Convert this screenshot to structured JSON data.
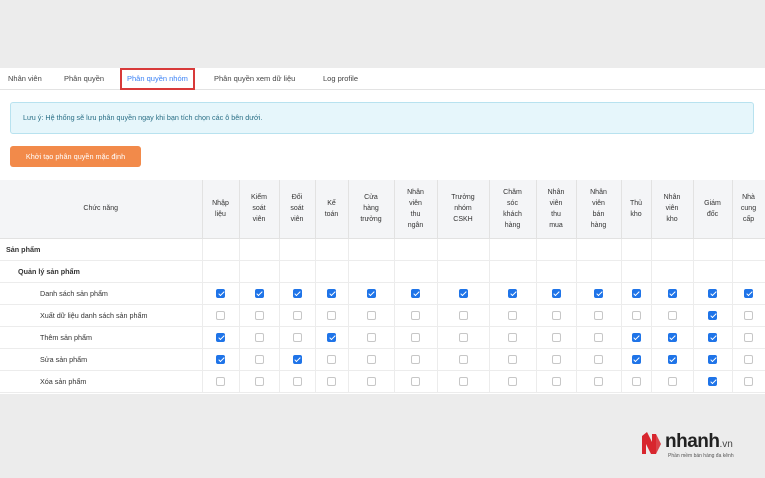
{
  "tabs": [
    {
      "label": "Nhân viên",
      "active": false
    },
    {
      "label": "Phân quyền",
      "active": false
    },
    {
      "label": "Phân quyền nhóm",
      "active": true
    },
    {
      "label": "Phân quyền xem dữ liệu",
      "active": false
    },
    {
      "label": "Log profile",
      "active": false
    }
  ],
  "notice": "Lưu ý: Hệ thống sẽ lưu phân quyền ngay khi bạn tích chọn các ô bên dưới.",
  "init_button": "Khởi tạo phân quyền mặc định",
  "table": {
    "function_header": "Chức năng",
    "columns": [
      [
        "Nhập",
        "liệu"
      ],
      [
        "Kiểm",
        "soát",
        "viên"
      ],
      [
        "Đối",
        "soát",
        "viên"
      ],
      [
        "Kế",
        "toán"
      ],
      [
        "Cửa",
        "hàng",
        "trưởng"
      ],
      [
        "Nhân",
        "viên",
        "thu",
        "ngân"
      ],
      [
        "Trưởng",
        "nhóm",
        "CSKH"
      ],
      [
        "Chăm",
        "sóc",
        "khách",
        "hàng"
      ],
      [
        "Nhân",
        "viên",
        "thu",
        "mua"
      ],
      [
        "Nhân",
        "viên",
        "bán",
        "hàng"
      ],
      [
        "Thủ",
        "kho"
      ],
      [
        "Nhân",
        "viên",
        "kho"
      ],
      [
        "Giám",
        "đốc"
      ],
      [
        "Nhà",
        "cung",
        "cấp"
      ]
    ],
    "rows": [
      {
        "label": "Sản phẩm",
        "level": 0,
        "checks": null
      },
      {
        "label": "Quản lý sản phẩm",
        "level": 1,
        "checks": null
      },
      {
        "label": "Danh sách sản phẩm",
        "level": 2,
        "checks": [
          1,
          1,
          1,
          1,
          1,
          1,
          1,
          1,
          1,
          1,
          1,
          1,
          1,
          1
        ]
      },
      {
        "label": "Xuất dữ liệu danh sách sản phẩm",
        "level": 2,
        "checks": [
          0,
          0,
          0,
          0,
          0,
          0,
          0,
          0,
          0,
          0,
          0,
          0,
          1,
          0
        ]
      },
      {
        "label": "Thêm sản phẩm",
        "level": 2,
        "checks": [
          1,
          0,
          0,
          1,
          0,
          0,
          0,
          0,
          0,
          0,
          1,
          1,
          1,
          0
        ]
      },
      {
        "label": "Sửa sản phẩm",
        "level": 2,
        "checks": [
          1,
          0,
          1,
          0,
          0,
          0,
          0,
          0,
          0,
          0,
          1,
          1,
          1,
          0
        ]
      },
      {
        "label": "Xóa sản phẩm",
        "level": 2,
        "checks": [
          0,
          0,
          0,
          0,
          0,
          0,
          0,
          0,
          0,
          0,
          0,
          0,
          1,
          0
        ]
      }
    ]
  },
  "logo": {
    "name": "nhanh",
    "tld": ".vn",
    "tagline": "Phần mềm bán hàng đa kênh",
    "brand_color": "#d8262e"
  }
}
